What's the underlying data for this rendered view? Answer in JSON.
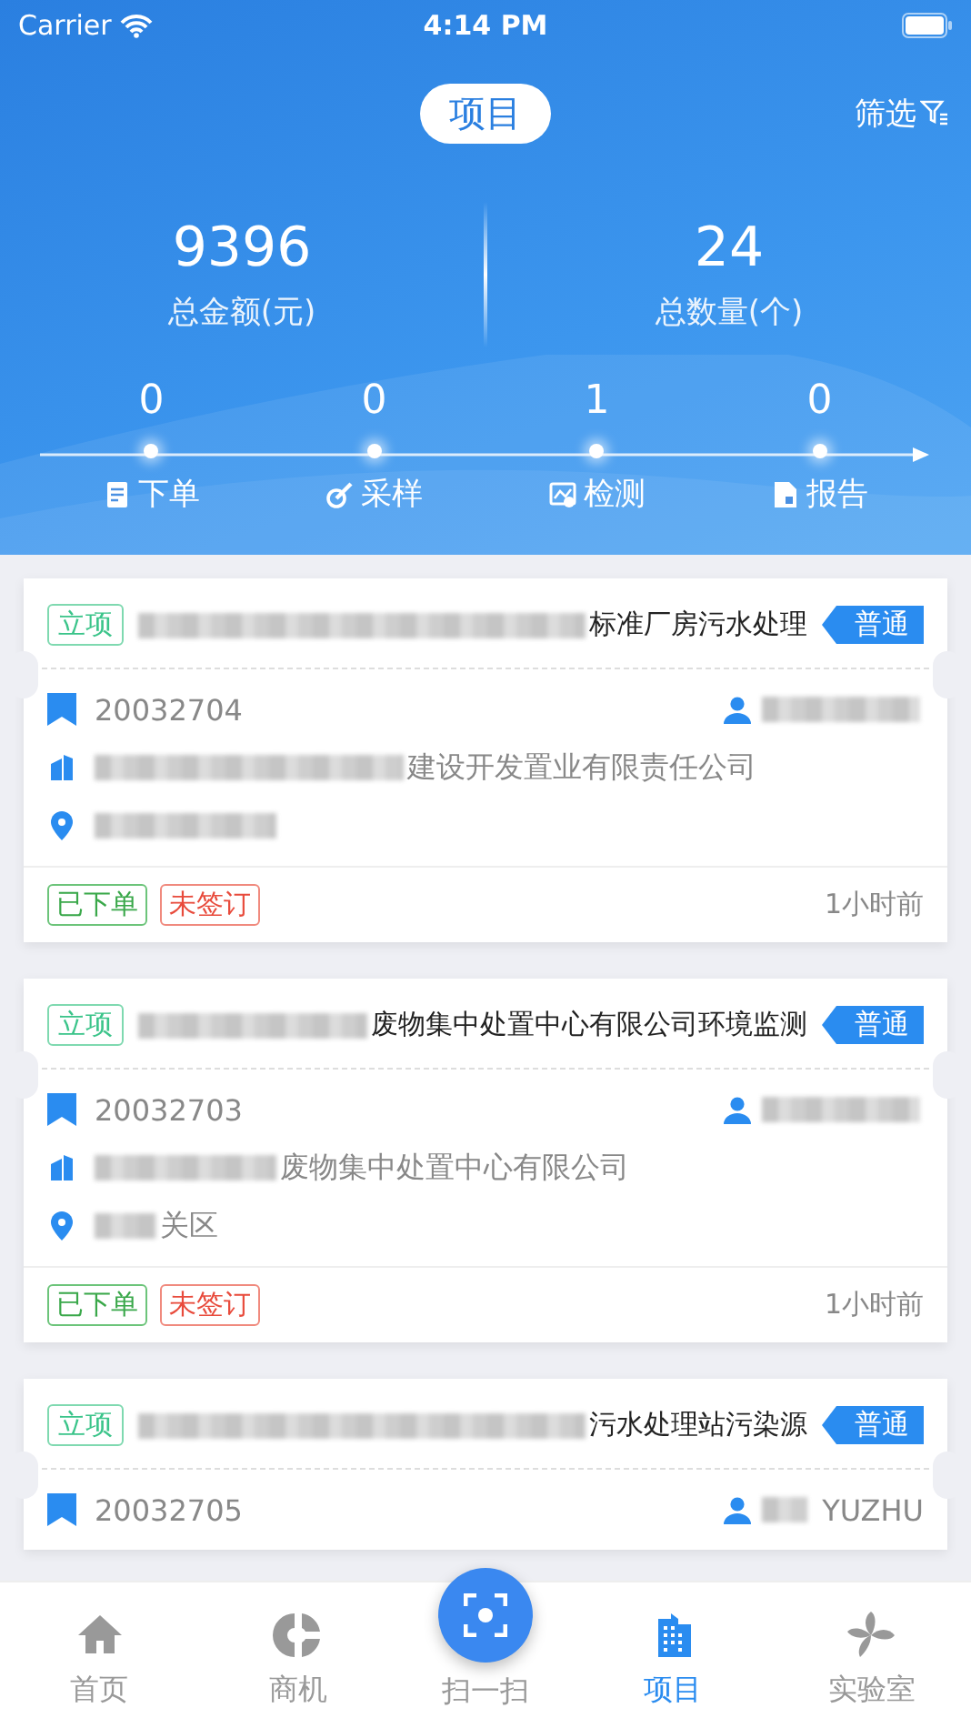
{
  "status_bar": {
    "carrier": "Carrier",
    "time": "4:14 PM"
  },
  "header": {
    "title": "项目",
    "filter": "筛选"
  },
  "stats": [
    {
      "value": "9396",
      "label": "总金额(元)"
    },
    {
      "value": "24",
      "label": "总数量(个)"
    }
  ],
  "steps": [
    {
      "count": "0",
      "label": "下单",
      "kind": "order"
    },
    {
      "count": "0",
      "label": "采样",
      "kind": "sample"
    },
    {
      "count": "1",
      "label": "检测",
      "kind": "test"
    },
    {
      "count": "0",
      "label": "报告",
      "kind": "report"
    }
  ],
  "projects": [
    {
      "stage": "立项",
      "title": "标准厂房污水处理",
      "title_redacted": true,
      "priority": "普通",
      "number": "20032704",
      "owner_redacted": true,
      "company": "建设开发置业有限责任公司",
      "company_redacted": true,
      "location_redacted": true,
      "tags": [
        {
          "label": "已下单",
          "kind": "done"
        },
        {
          "label": "未签订",
          "kind": "pending"
        }
      ],
      "time": "1小时前"
    },
    {
      "stage": "立项",
      "title": "废物集中处置中心有限公司环境监测",
      "title_redacted": true,
      "priority": "普通",
      "number": "20032703",
      "owner_redacted": true,
      "company": "废物集中处置中心有限公司",
      "company_redacted": true,
      "location": "关区",
      "location_redacted": true,
      "tags": [
        {
          "label": "已下单",
          "kind": "done"
        },
        {
          "label": "未签订",
          "kind": "pending"
        }
      ],
      "time": "1小时前"
    },
    {
      "stage": "立项",
      "title": "污水处理站污染源",
      "title_redacted": true,
      "priority": "普通",
      "number": "20032705",
      "owner": "YUZHU",
      "owner_redacted": true
    }
  ],
  "tab_bar": [
    {
      "label": "首页",
      "kind": "home",
      "selected": false
    },
    {
      "label": "商机",
      "kind": "chance",
      "selected": false
    },
    {
      "label": "扫一扫",
      "kind": "scan",
      "selected": false
    },
    {
      "label": "项目",
      "kind": "project",
      "selected": true
    },
    {
      "label": "实验室",
      "kind": "lab",
      "selected": false
    }
  ]
}
